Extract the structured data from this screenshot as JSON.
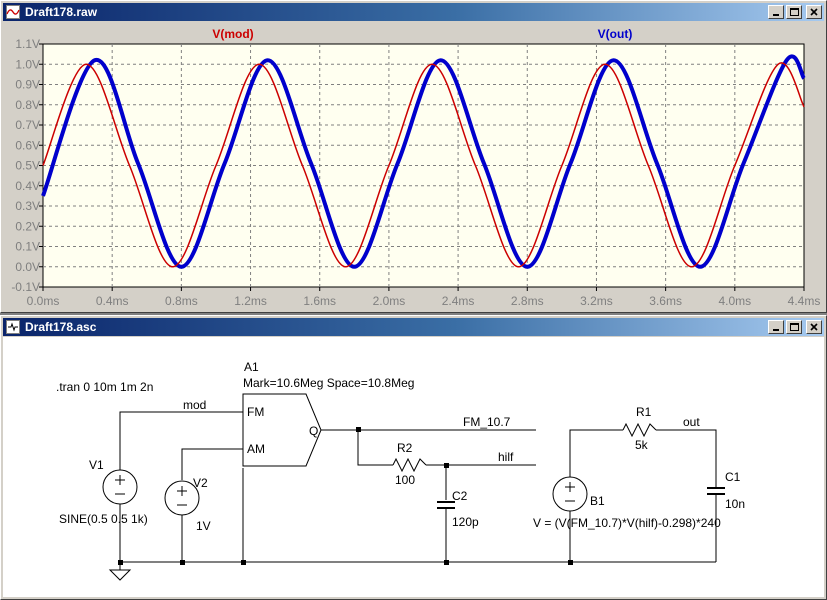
{
  "waveform_window": {
    "title": "Draft178.raw",
    "trace_labels": {
      "mod": "V(mod)",
      "out": "V(out)"
    },
    "colors": {
      "mod": "#cc0000",
      "out": "#0000cc",
      "plot_bg": "#fffff0",
      "grid": "#808080",
      "tick_text": "#7f7f7f"
    }
  },
  "schematic_window": {
    "title": "Draft178.asc",
    "labels": {
      "tran": ".tran 0 10m 1m 2n",
      "a1_name": "A1",
      "a1_params": "Mark=10.6Meg Space=10.8Meg",
      "a1_fm": "FM",
      "a1_am": "AM",
      "a1_q": "Q",
      "net_mod": "mod",
      "net_fm": "FM_10.7",
      "net_hilf": "hilf",
      "net_out": "out",
      "v1_name": "V1",
      "v1_value": "SINE(0.5 0.5 1k)",
      "v2_name": "V2",
      "v2_value": "1V",
      "r2_name": "R2",
      "r2_value": "100",
      "c2_name": "C2",
      "c2_value": "120p",
      "r1_name": "R1",
      "r1_value": "5k",
      "c1_name": "C1",
      "c1_value": "10n",
      "b1_name": "B1",
      "b1_expr": "V = (V(FM_10.7)*V(hilf)-0.298)*240"
    }
  },
  "chart_data": {
    "type": "line",
    "title": "",
    "xlabel": "",
    "ylabel": "",
    "xlim": [
      0,
      4.4
    ],
    "ylim": [
      -0.1,
      1.1
    ],
    "x_ticks": [
      "0.0ms",
      "0.4ms",
      "0.8ms",
      "1.2ms",
      "1.6ms",
      "2.0ms",
      "2.4ms",
      "2.8ms",
      "3.2ms",
      "3.6ms",
      "4.0ms",
      "4.4ms"
    ],
    "y_ticks": [
      "-0.1V",
      "0.0V",
      "0.1V",
      "0.2V",
      "0.3V",
      "0.4V",
      "0.5V",
      "0.6V",
      "0.7V",
      "0.8V",
      "0.9V",
      "1.0V",
      "1.1V"
    ],
    "grid": true,
    "legend": "top",
    "series": [
      {
        "name": "V(mod)",
        "x": [
          0.0,
          0.25,
          0.5,
          0.75,
          1.0,
          1.25,
          1.5,
          1.75,
          2.0,
          2.25,
          2.5,
          2.75,
          3.0,
          3.25,
          3.5,
          3.75,
          4.0,
          4.25,
          4.4
        ],
        "y": [
          0.5,
          1.0,
          0.5,
          0.0,
          0.5,
          1.0,
          0.5,
          0.0,
          0.5,
          1.0,
          0.5,
          0.0,
          0.5,
          1.0,
          0.5,
          0.0,
          0.5,
          1.0,
          0.79
        ]
      },
      {
        "name": "V(out)",
        "x": [
          0.0,
          0.3,
          0.55,
          0.8,
          1.05,
          1.3,
          1.55,
          1.8,
          2.05,
          2.3,
          2.55,
          2.8,
          3.05,
          3.3,
          3.55,
          3.8,
          4.05,
          4.3,
          4.4
        ],
        "y": [
          0.35,
          1.02,
          0.51,
          0.0,
          0.51,
          1.02,
          0.51,
          0.0,
          0.51,
          1.02,
          0.51,
          0.0,
          0.51,
          1.02,
          0.51,
          0.0,
          0.51,
          1.02,
          0.93
        ]
      }
    ]
  }
}
